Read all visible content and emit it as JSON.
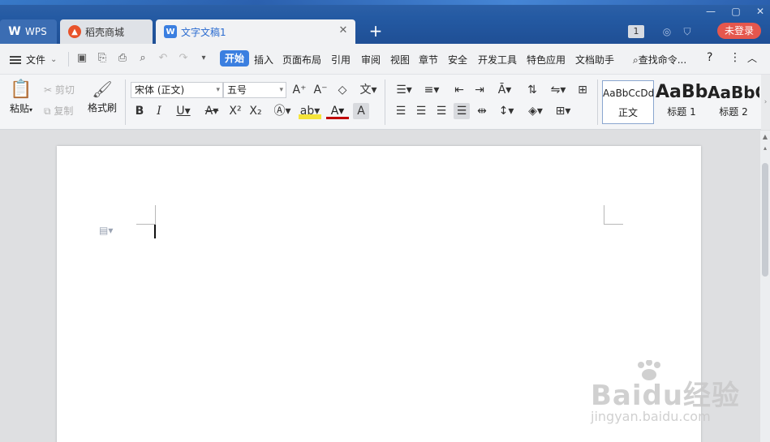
{
  "titlebar": {
    "tabs": [
      {
        "label": "WPS",
        "icon": "wps-logo-icon"
      },
      {
        "label": "稻壳商城",
        "icon": "docer-flame-icon"
      },
      {
        "label": "文字文稿1",
        "icon": "writer-doc-icon"
      }
    ],
    "window_badge": "1",
    "login_label": "未登录",
    "colors": {
      "titlebar": "#245aa3",
      "login": "#e5574d",
      "accent": "#3b7fe0"
    }
  },
  "menubar": {
    "file_label": "文件",
    "items": [
      "开始",
      "插入",
      "页面布局",
      "引用",
      "审阅",
      "视图",
      "章节",
      "安全",
      "开发工具",
      "特色应用",
      "文档助手"
    ],
    "active_item": "开始",
    "search_label": "查找命令...",
    "help_symbol": "?"
  },
  "ribbon": {
    "clipboard": {
      "paste": "粘贴",
      "cut": "剪切",
      "copy": "复制",
      "format_painter": "格式刷"
    },
    "font": {
      "family": "宋体 (正文)",
      "size": "五号"
    },
    "styles": [
      {
        "preview": "AaBbCcDd",
        "label": "正文"
      },
      {
        "preview": "AaBb",
        "label": "标题 1"
      },
      {
        "preview": "AaBbC",
        "label": "标题 2"
      }
    ]
  },
  "watermark": {
    "logo": "Baidu经验",
    "url": "jingyan.baidu.com"
  }
}
